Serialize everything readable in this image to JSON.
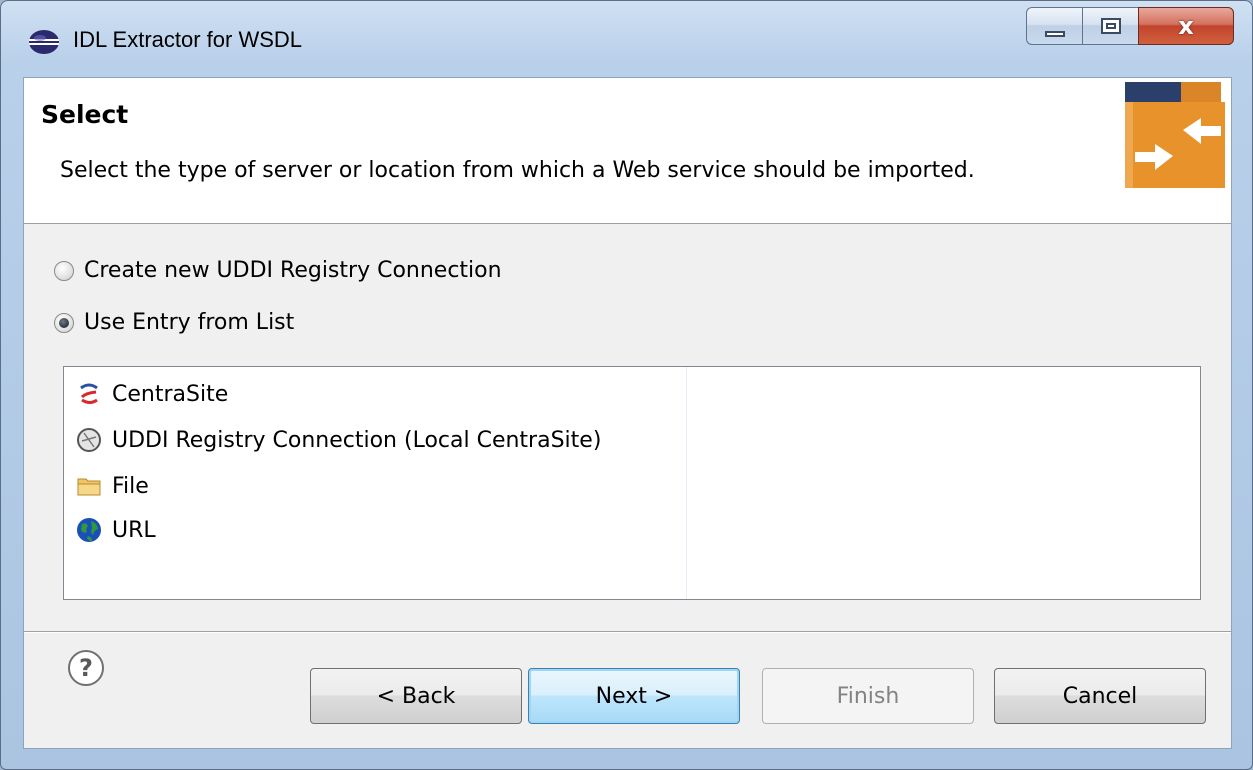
{
  "window": {
    "title": "IDL Extractor for WSDL",
    "close_glyph": "x"
  },
  "header": {
    "title": "Select",
    "description": "Select the type of server or location from which a Web service should be imported."
  },
  "options": [
    {
      "label": "Create new UDDI Registry Connection",
      "checked": false
    },
    {
      "label": "Use Entry from List",
      "checked": true
    }
  ],
  "list": {
    "items": [
      {
        "label": "CentraSite",
        "icon": "centrasite-icon"
      },
      {
        "label": "UDDI Registry Connection (Local CentraSite)",
        "icon": "uddi-registry-icon"
      },
      {
        "label": "File",
        "icon": "folder-icon"
      },
      {
        "label": "URL",
        "icon": "globe-icon"
      }
    ]
  },
  "buttons": {
    "back": "< Back",
    "next": "Next >",
    "finish": "Finish",
    "cancel": "Cancel",
    "help": "?"
  },
  "colors": {
    "accent_orange": "#e8922c",
    "default_button_border": "#3c7fb1"
  }
}
